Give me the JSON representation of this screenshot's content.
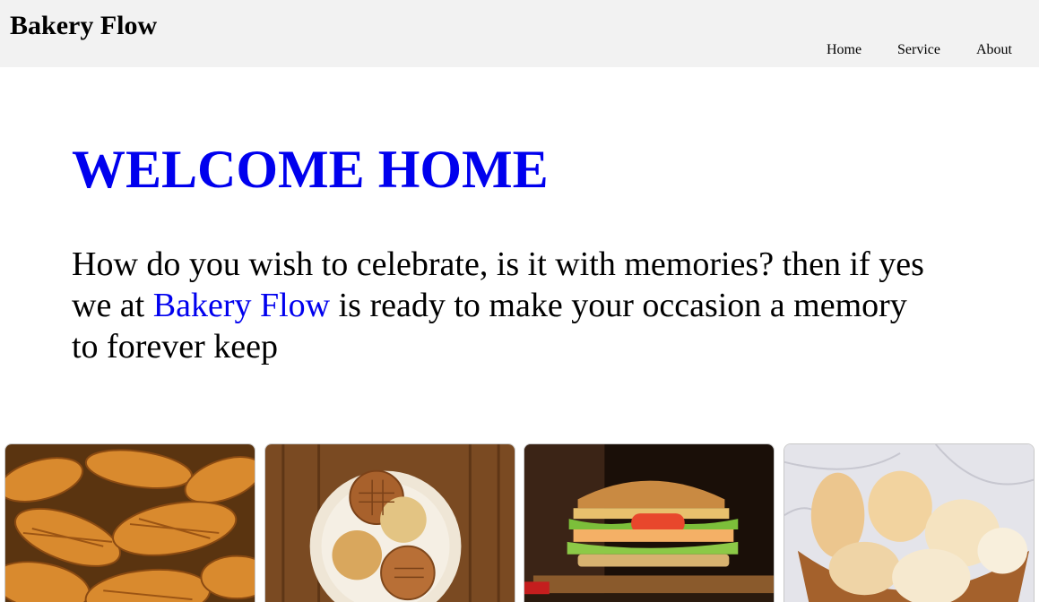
{
  "header": {
    "brand": "Bakery Flow",
    "nav": [
      {
        "label": "Home"
      },
      {
        "label": "Service"
      },
      {
        "label": "About"
      }
    ]
  },
  "hero": {
    "title": "WELCOME HOME",
    "text_before": "How do you wish to celebrate, is it with memories? then if yes we at ",
    "text_highlight": "Bakery Flow",
    "text_after": " is ready to make your occasion a memory to forever keep"
  },
  "colors": {
    "accent": "#0000ee",
    "header_bg": "#f2f2f2"
  },
  "gallery": [
    {
      "icon": "croissants-photo"
    },
    {
      "icon": "cookies-bowl-photo"
    },
    {
      "icon": "burger-photo"
    },
    {
      "icon": "bread-basket-photo"
    }
  ]
}
